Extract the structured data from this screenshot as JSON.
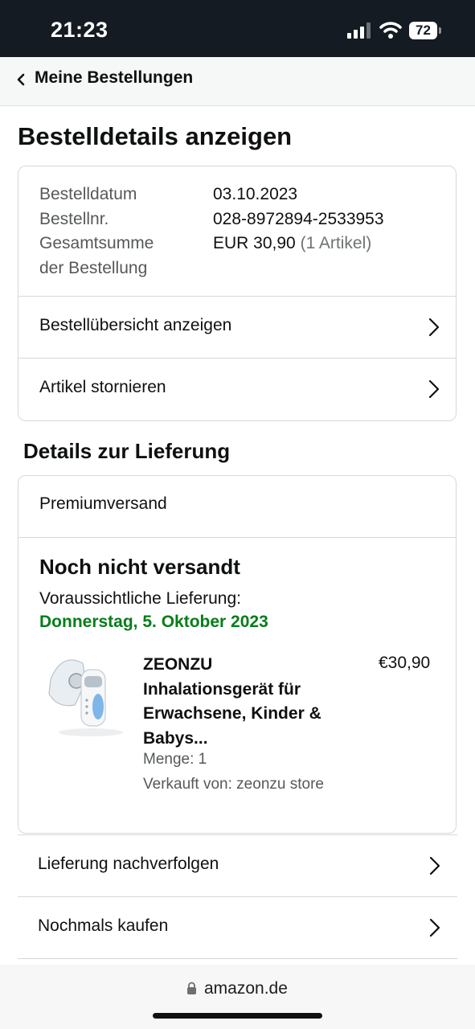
{
  "status_bar": {
    "time": "21:23",
    "battery": "72"
  },
  "nav": {
    "back_label": "Meine Bestellungen"
  },
  "page": {
    "title": "Bestelldetails anzeigen"
  },
  "order": {
    "date_label": "Bestelldatum",
    "date_value": "03.10.2023",
    "number_label": "Bestellnr.",
    "number_value": "028-8972894-2533953",
    "total_label_line1": "Gesamtsumme",
    "total_label_line2": "der Bestellung",
    "total_value": "EUR 30,90",
    "total_items": "(1 Artikel)",
    "links": [
      {
        "label": "Bestellübersicht anzeigen"
      },
      {
        "label": "Artikel stornieren"
      }
    ]
  },
  "delivery": {
    "section_title": "Details zur Lieferung",
    "shipping_type": "Premiumversand",
    "status": "Noch nicht versandt",
    "eta_label": "Voraussichtliche Lieferung:",
    "eta_date": "Donnerstag, 5. Oktober 2023",
    "eta_color": "#067d1a",
    "item": {
      "name_line1": "ZEONZU",
      "name_line2": "Inhalationsgerät für",
      "name_line3": "Erwachsene, Kinder &",
      "name_line4": "Babys...",
      "price": "€30,90",
      "quantity": "Menge: 1",
      "seller": "Verkauft von: zeonzu store"
    }
  },
  "actions": [
    {
      "label": "Lieferung nachverfolgen"
    },
    {
      "label": "Nochmals kaufen"
    }
  ],
  "browser": {
    "domain": "amazon.de"
  }
}
